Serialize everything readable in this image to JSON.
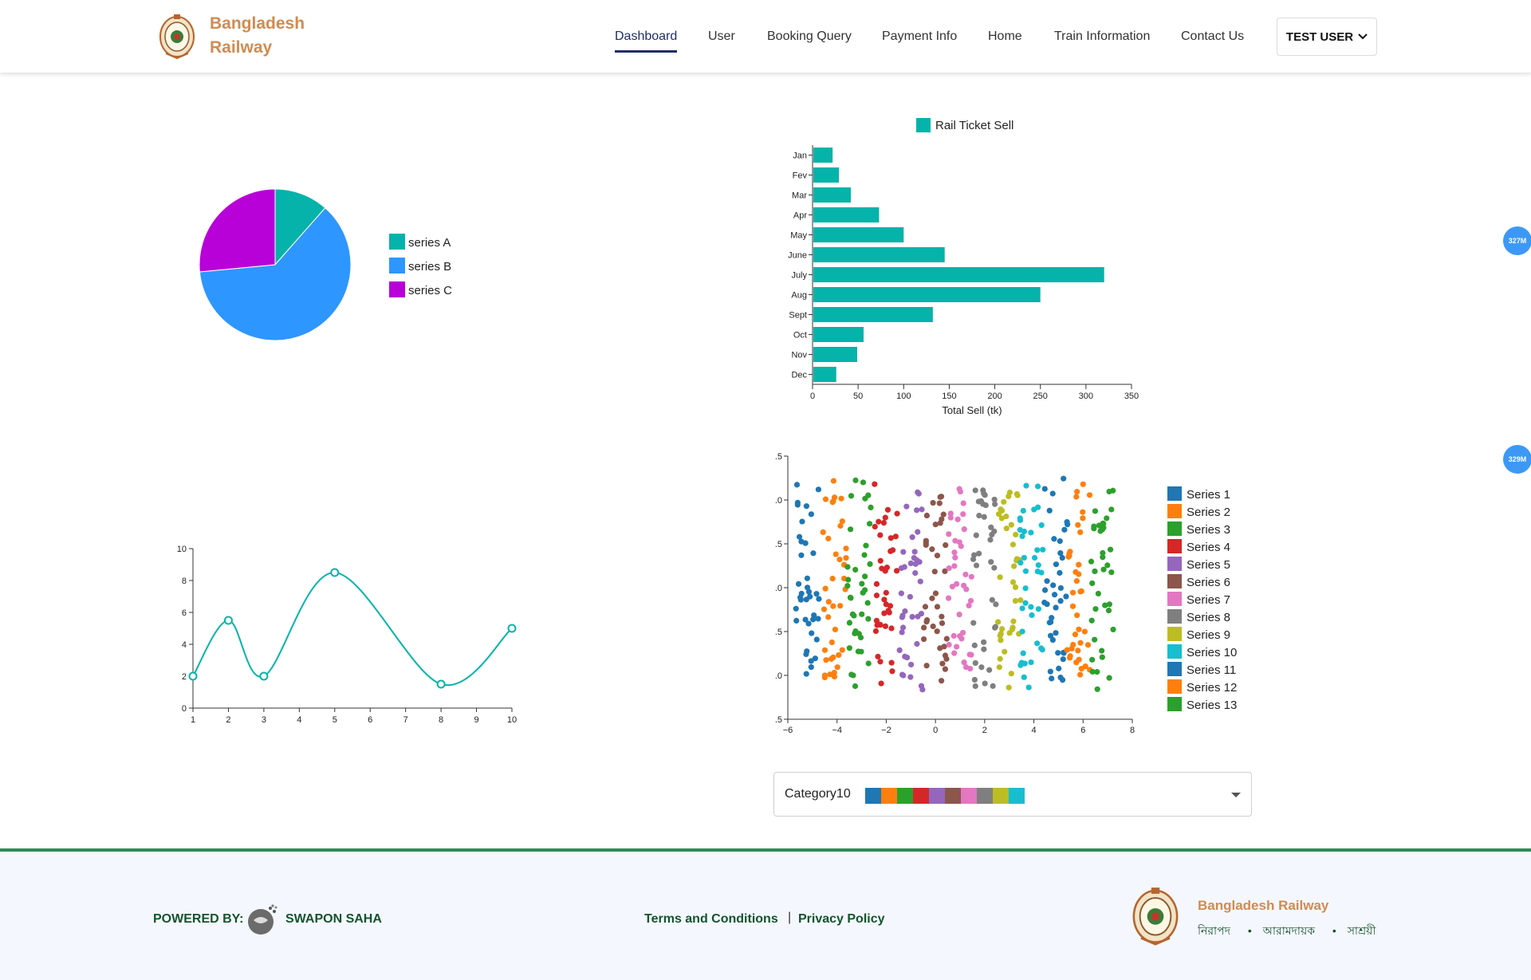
{
  "header": {
    "brand_line1": "Bangladesh",
    "brand_line2": "Railway",
    "nav": [
      "Dashboard",
      "User",
      "Booking Query",
      "Payment Info",
      "Home",
      "Train Information",
      "Contact Us"
    ],
    "active_nav": "Dashboard",
    "user_label": "TEST USER"
  },
  "side_badges": [
    "327M",
    "329M"
  ],
  "pie_chart": {
    "chart_data": {
      "type": "pie",
      "labels": [
        "series A",
        "series B",
        "series C"
      ],
      "values": [
        11.5,
        62,
        26.5
      ],
      "colors": [
        "#05b3aa",
        "#2e96ff",
        "#b800d8"
      ]
    }
  },
  "bar_chart": {
    "chart_data": {
      "type": "bar",
      "orientation": "horizontal",
      "categories": [
        "Jan",
        "Fev",
        "Mar",
        "Apr",
        "May",
        "June",
        "July",
        "Aug",
        "Sept",
        "Oct",
        "Nov",
        "Dec"
      ],
      "series": [
        {
          "name": "Rail Ticket Sell",
          "values": [
            22,
            29,
            42,
            73,
            100,
            145,
            320,
            250,
            132,
            56,
            49,
            26
          ]
        }
      ],
      "xlabel": "Total Sell (tk)",
      "xlim": [
        0,
        350
      ],
      "xticks": [
        0,
        50,
        100,
        150,
        200,
        250,
        300,
        350
      ],
      "color": "#05b3aa",
      "legend": "top"
    }
  },
  "line_chart": {
    "chart_data": {
      "type": "line",
      "x": [
        1,
        2,
        3,
        5,
        8,
        10
      ],
      "y": [
        2,
        5.5,
        2,
        8.5,
        1.5,
        5
      ],
      "xlim": [
        1,
        10
      ],
      "ylim": [
        0,
        10
      ],
      "xticks": [
        1,
        2,
        3,
        4,
        5,
        6,
        7,
        8,
        9,
        10
      ],
      "yticks": [
        0,
        2,
        4,
        6,
        8,
        10
      ],
      "color": "#05b3aa",
      "curve": "smooth"
    }
  },
  "scatter_chart": {
    "chart_data": {
      "type": "scatter",
      "xlim": [
        -6,
        8
      ],
      "ylim": [
        -2.5,
        2.5
      ],
      "xticks": [
        -6,
        -4,
        -2,
        0,
        2,
        4,
        6,
        8
      ],
      "yticks": [
        ".5",
        ".0",
        ".5",
        ".0",
        ".5",
        ".0",
        ".5"
      ],
      "series_names": [
        "Series 1",
        "Series 2",
        "Series 3",
        "Series 4",
        "Series 5",
        "Series 6",
        "Series 7",
        "Series 8",
        "Series 9",
        "Series 10",
        "Series 11",
        "Series 12",
        "Series 13"
      ],
      "series_center_x": [
        -5.2,
        -4.1,
        -3.1,
        -2.0,
        -1.0,
        0.0,
        1.0,
        2.0,
        3.0,
        3.9,
        4.9,
        5.8,
        6.8
      ],
      "points_per_series": 38,
      "y_spread": [
        -1.8,
        2.0
      ],
      "colors": [
        "#1f77b4",
        "#ff7f0e",
        "#2ca02c",
        "#d62728",
        "#9467bd",
        "#8c564b",
        "#e377c2",
        "#7f7f7f",
        "#bcbd22",
        "#17becf",
        "#1f77b4",
        "#ff7f0e",
        "#2ca02c"
      ],
      "legend": "right"
    }
  },
  "color_select": {
    "label": "Category10",
    "swatches": [
      "#1f77b4",
      "#ff7f0e",
      "#2ca02c",
      "#d62728",
      "#9467bd",
      "#8c564b",
      "#e377c2",
      "#7f7f7f",
      "#bcbd22",
      "#17becf"
    ]
  },
  "footer": {
    "powered_by": "POWERED BY:",
    "author": "SWAPON SAHA",
    "terms": "Terms and Conditions",
    "separator": "|",
    "privacy": "Privacy Policy",
    "brand": "Bangladesh Railway",
    "tagline": [
      "নিরাপদ",
      "আরামদায়ক",
      "সাশ্রয়ী"
    ]
  }
}
